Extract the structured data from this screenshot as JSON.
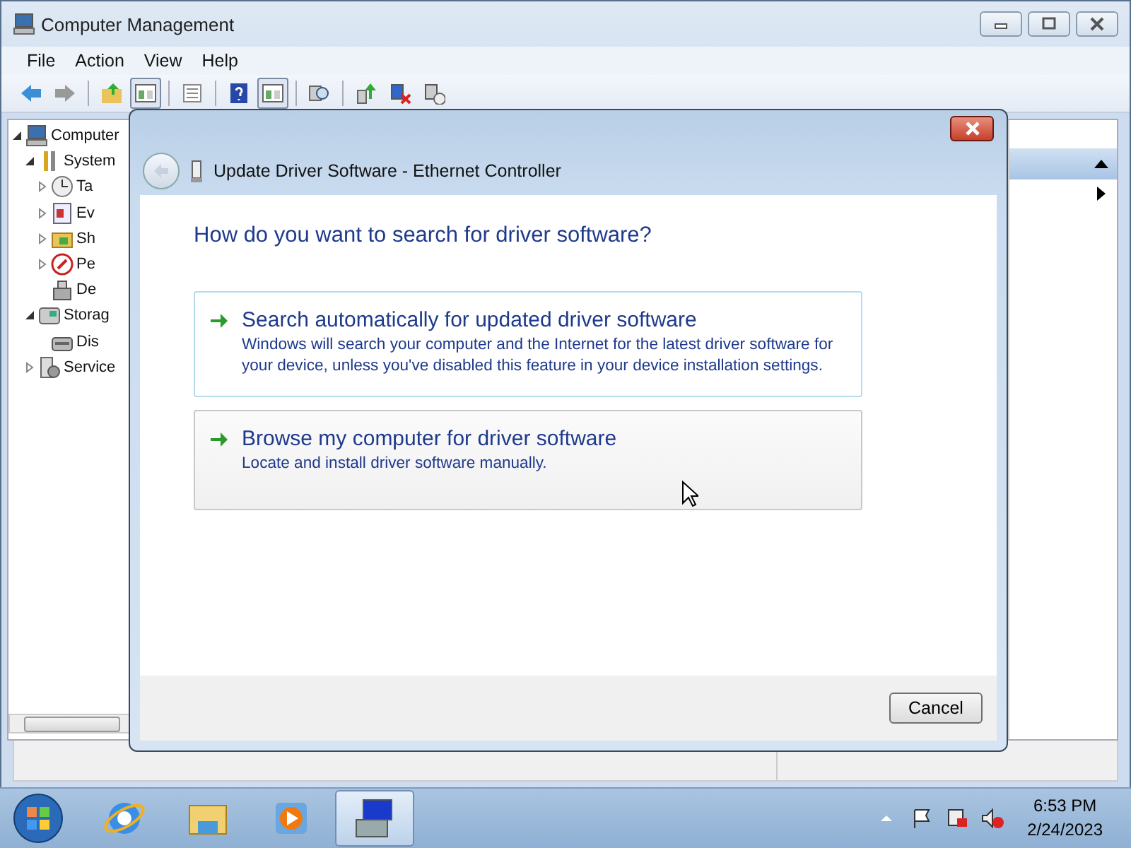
{
  "window": {
    "title": "Computer Management"
  },
  "menu": [
    "File",
    "Action",
    "View",
    "Help"
  ],
  "toolbar": [
    {
      "kind": "back",
      "pressed": false
    },
    {
      "kind": "forward",
      "pressed": false
    },
    {
      "kind": "sep"
    },
    {
      "kind": "up",
      "pressed": false
    },
    {
      "kind": "pane",
      "pressed": true
    },
    {
      "kind": "sep"
    },
    {
      "kind": "list",
      "pressed": false
    },
    {
      "kind": "sep"
    },
    {
      "kind": "help",
      "pressed": false
    },
    {
      "kind": "pane",
      "pressed": true
    },
    {
      "kind": "sep"
    },
    {
      "kind": "scan",
      "pressed": false
    },
    {
      "kind": "sep"
    },
    {
      "kind": "update",
      "pressed": false
    },
    {
      "kind": "remove",
      "pressed": false
    },
    {
      "kind": "install",
      "pressed": false
    }
  ],
  "tree": [
    {
      "label": "Computer",
      "kind": "computer",
      "expanded": true,
      "children": [
        {
          "label": "System",
          "kind": "tools",
          "expanded": true,
          "children": [
            {
              "label": "Ta",
              "kind": "clock",
              "expanded": false
            },
            {
              "label": "Ev",
              "kind": "log",
              "expanded": false
            },
            {
              "label": "Sh",
              "kind": "share",
              "expanded": false
            },
            {
              "label": "Pe",
              "kind": "perf",
              "expanded": false
            },
            {
              "label": "De",
              "kind": "device"
            }
          ]
        },
        {
          "label": "Storag",
          "kind": "storage",
          "expanded": true,
          "children": [
            {
              "label": "Dis",
              "kind": "disk"
            }
          ]
        },
        {
          "label": "Service",
          "kind": "services",
          "expanded": false
        }
      ]
    }
  ],
  "dialog": {
    "title": "Update Driver Software - Ethernet Controller",
    "heading": "How do you want to search for driver software?",
    "options": [
      {
        "title": "Search automatically for updated driver software",
        "description": "Windows will search your computer and the Internet for the latest driver software for your device, unless you've disabled this feature in your device installation settings.",
        "hovered": false
      },
      {
        "title": "Browse my computer for driver software",
        "description": "Locate and install driver software manually.",
        "hovered": true
      }
    ],
    "buttons": [
      "Cancel"
    ]
  },
  "taskbar": {
    "apps": [
      {
        "kind": "ie",
        "active": false
      },
      {
        "kind": "explorer",
        "active": false
      },
      {
        "kind": "media",
        "active": false
      },
      {
        "kind": "compmgmt",
        "active": true
      }
    ],
    "tray": [
      {
        "kind": "chevron"
      },
      {
        "kind": "flag"
      },
      {
        "kind": "network"
      },
      {
        "kind": "speaker"
      }
    ],
    "time": "6:53 PM",
    "date": "2/24/2023"
  }
}
